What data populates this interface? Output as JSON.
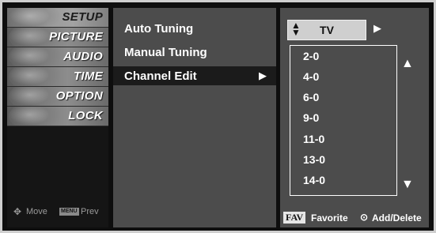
{
  "left_menu": {
    "items": [
      {
        "label": "SETUP",
        "selected": true
      },
      {
        "label": "PICTURE",
        "selected": false
      },
      {
        "label": "AUDIO",
        "selected": false
      },
      {
        "label": "TIME",
        "selected": false
      },
      {
        "label": "OPTION",
        "selected": false
      },
      {
        "label": "LOCK",
        "selected": false
      }
    ],
    "hint": {
      "move_icon": "move-icon",
      "move_label": "Move",
      "menu_key": "MENU",
      "prev_label": "Prev"
    }
  },
  "submenu": {
    "items": [
      {
        "label": "Auto Tuning",
        "selected": false
      },
      {
        "label": "Manual Tuning",
        "selected": false
      },
      {
        "label": "Channel Edit",
        "selected": true,
        "arrow": "▶"
      }
    ]
  },
  "right_panel": {
    "source": {
      "updown": "▲▼",
      "label": "TV",
      "next_arrow": "▶"
    },
    "channels": [
      "2-0",
      "4-0",
      "6-0",
      "9-0",
      "11-0",
      "13-0",
      "14-0"
    ],
    "scroll_up": "▲",
    "scroll_down": "▼",
    "legend": {
      "fav_key": "FAV",
      "fav_label": "Favorite",
      "ok_icon": "⊙",
      "add_delete_label": "Add/Delete"
    }
  },
  "colors": {
    "background": "#0e0e0e",
    "panel": "#4c4c4c",
    "selected_row": "#1b1b1b",
    "text": "#ffffff"
  }
}
